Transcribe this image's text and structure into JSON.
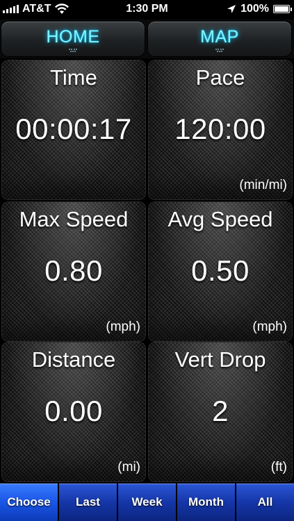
{
  "status_bar": {
    "carrier": "AT&T",
    "time": "1:30 PM",
    "battery": "100%",
    "battery_level": 1.0
  },
  "header": {
    "tabs": [
      {
        "label": "HOME"
      },
      {
        "label": "MAP"
      }
    ],
    "accent_color": "#7ff4ff"
  },
  "stats": {
    "time": {
      "label": "Time",
      "value": "00:00:17",
      "unit": ""
    },
    "pace": {
      "label": "Pace",
      "value": "120:00",
      "unit": "(min/mi)"
    },
    "max_speed": {
      "label": "Max Speed",
      "value": "0.80",
      "unit": "(mph)"
    },
    "avg_speed": {
      "label": "Avg Speed",
      "value": "0.50",
      "unit": "(mph)"
    },
    "distance": {
      "label": "Distance",
      "value": "0.00",
      "unit": "(mi)"
    },
    "vert_drop": {
      "label": "Vert Drop",
      "value": "2",
      "unit": "(ft)"
    }
  },
  "bottom_bar": {
    "buttons": [
      {
        "label": "Choose"
      },
      {
        "label": "Last"
      },
      {
        "label": "Week"
      },
      {
        "label": "Month"
      },
      {
        "label": "All"
      }
    ],
    "button_color": "#1a44c4"
  }
}
